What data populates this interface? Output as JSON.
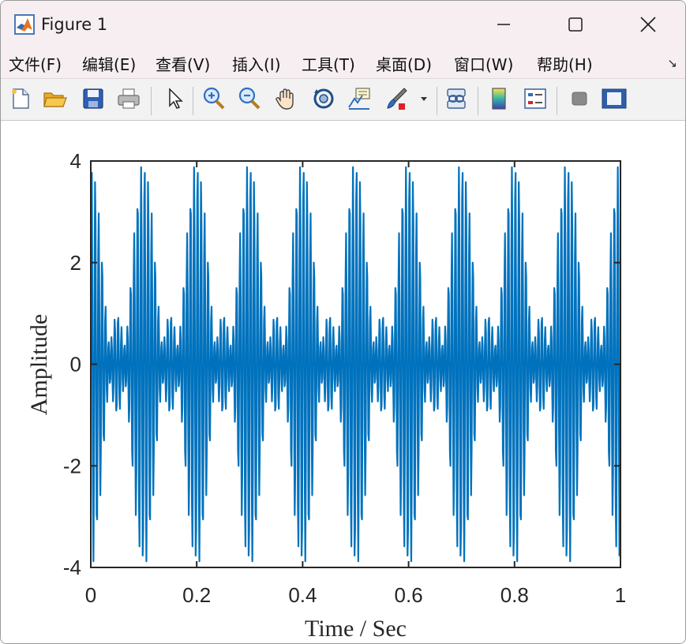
{
  "window": {
    "title": "Figure 1",
    "controls": [
      "minimize",
      "maximize",
      "close"
    ]
  },
  "menu": {
    "items": [
      "文件(F)",
      "编辑(E)",
      "查看(V)",
      "插入(I)",
      "工具(T)",
      "桌面(D)",
      "窗口(W)",
      "帮助(H)"
    ]
  },
  "toolbar": {
    "buttons": [
      "new-figure",
      "open-file",
      "save",
      "print",
      "edit-plot-pointer",
      "zoom-in",
      "zoom-out",
      "pan",
      "rotate-3d",
      "data-cursor",
      "brush",
      "brush-dropdown",
      "link-plot",
      "colorbar",
      "legend",
      "hide-plot-tools",
      "show-plot-tools"
    ]
  },
  "colors": {
    "line": "#0072bd",
    "titlebar": "#f6eef1",
    "toolbar": "#f2f2f2"
  },
  "chart_data": {
    "type": "line",
    "xlabel": "Time / Sec",
    "ylabel": "Amplitude",
    "xlim": [
      0,
      1
    ],
    "ylim": [
      -4,
      4
    ],
    "xticks": [
      "0",
      "0.2",
      "0.4",
      "0.6",
      "0.8",
      "1"
    ],
    "yticks": [
      "4",
      "2",
      "0",
      "-2",
      "-4"
    ],
    "grid": false,
    "series": [
      {
        "signal": "sum of three sinusoids",
        "components": [
          {
            "amplitude": 1,
            "frequency_hz": 140
          },
          {
            "amplitude": 1.5,
            "frequency_hz": 150
          },
          {
            "amplitude": 1.5,
            "frequency_hz": 160
          }
        ],
        "t_start": 0,
        "t_end": 1,
        "sample_step": 0.001
      }
    ]
  }
}
